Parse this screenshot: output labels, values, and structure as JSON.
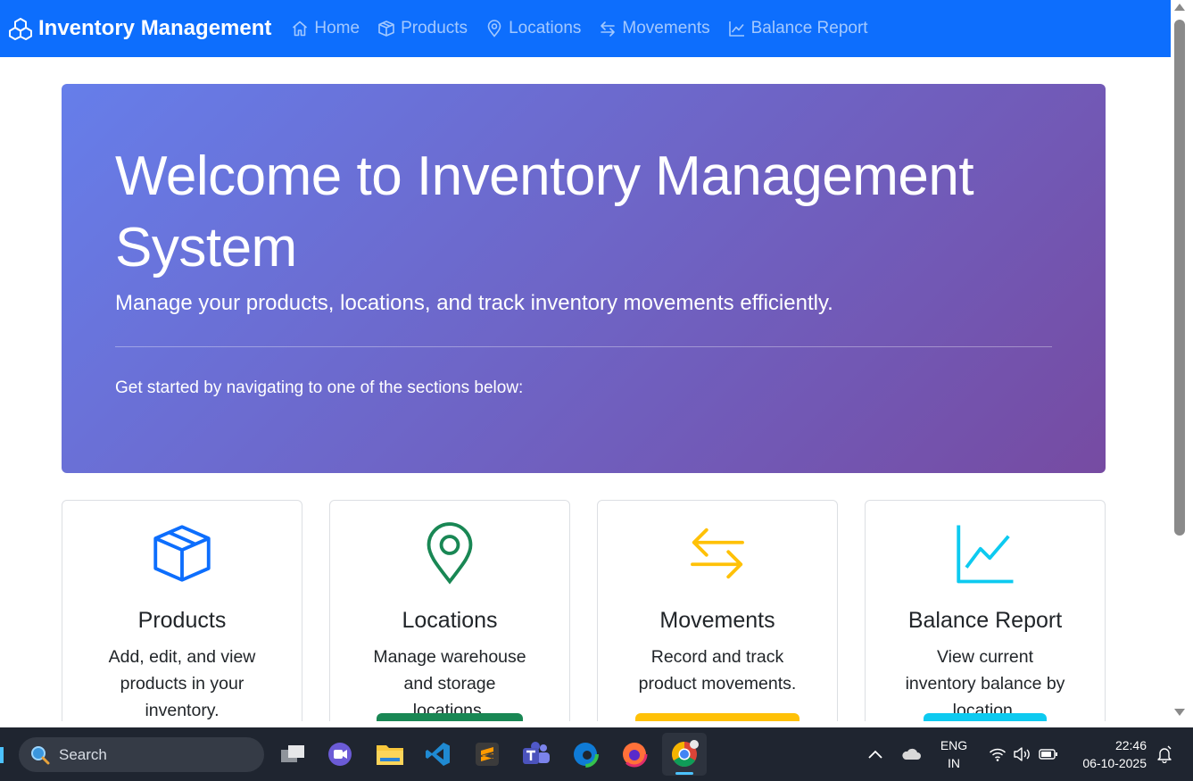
{
  "navbar": {
    "brand": "Inventory Management",
    "items": [
      {
        "label": "Home",
        "icon": "house-icon"
      },
      {
        "label": "Products",
        "icon": "box-icon"
      },
      {
        "label": "Locations",
        "icon": "geo-pin-icon"
      },
      {
        "label": "Movements",
        "icon": "arrow-left-right-icon"
      },
      {
        "label": "Balance Report",
        "icon": "graph-up-icon"
      }
    ]
  },
  "hero": {
    "title": "Welcome to Inventory Management System",
    "lead": "Manage your products, locations, and track inventory movements efficiently.",
    "subtext": "Get started by navigating to one of the sections below:"
  },
  "cards": [
    {
      "title": "Products",
      "text": "Add, edit, and view products in your inventory.",
      "icon": "box-icon",
      "color": "#0d6efd"
    },
    {
      "title": "Locations",
      "text": "Manage warehouse and storage locations.",
      "icon": "geo-pin-icon",
      "color": "#198754"
    },
    {
      "title": "Movements",
      "text": "Record and track product movements.",
      "icon": "arrow-left-right-icon",
      "color": "#ffc107"
    },
    {
      "title": "Balance Report",
      "text": "View current inventory balance by location.",
      "icon": "graph-up-icon",
      "color": "#0dcaf0"
    }
  ],
  "taskbar": {
    "search_placeholder": "Search",
    "language": "ENG",
    "region": "IN",
    "time": "22:46",
    "date": "06-10-2025"
  },
  "colors": {
    "navbar": "#0d6efd",
    "hero_gradient_start": "#667eea",
    "hero_gradient_end": "#764ba2"
  }
}
